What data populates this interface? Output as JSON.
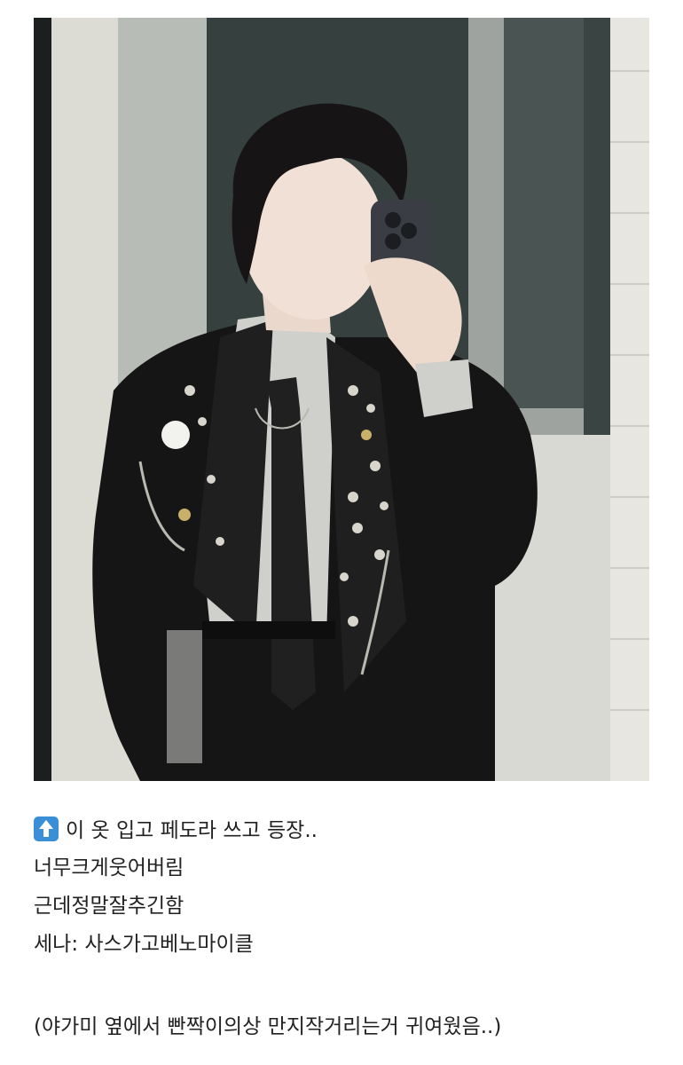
{
  "post": {
    "lines": [
      {
        "icon": "up-arrow-emoji-icon",
        "text": "이 옷 입고 페도라 쓰고 등장.."
      },
      {
        "text": "너무크게웃어버림"
      },
      {
        "text": "근데정말잘추긴함"
      },
      {
        "text": "세나: 사스가고베노마이클"
      },
      {
        "text": ""
      },
      {
        "text": "(야가미 옆에서 빤짝이의상 만지작거리는거 귀여웠음..)"
      }
    ]
  },
  "colors": {
    "background": "#ffffff",
    "text": "#222222",
    "emoji_blue": "#3b8fd6"
  }
}
